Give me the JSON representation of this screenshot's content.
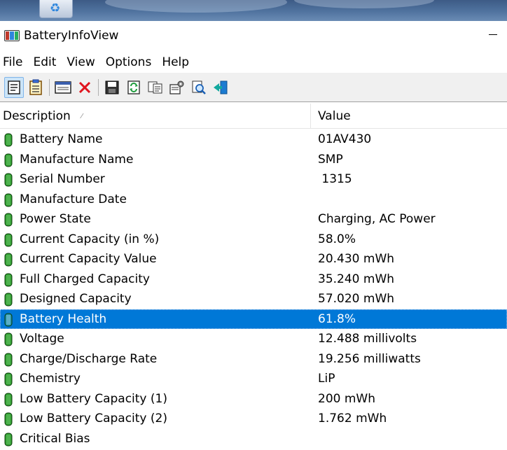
{
  "window": {
    "title": "BatteryInfoView"
  },
  "menu": [
    "File",
    "Edit",
    "View",
    "Options",
    "Help"
  ],
  "toolbar": {
    "buttons": [
      {
        "name": "properties-icon",
        "active": true
      },
      {
        "name": "clipboard-icon",
        "active": false
      },
      {
        "name": "html-report-icon",
        "active": false
      },
      {
        "name": "delete-icon",
        "active": false
      },
      {
        "name": "save-icon",
        "active": false
      },
      {
        "name": "refresh-icon",
        "active": false
      },
      {
        "name": "copy-icon",
        "active": false
      },
      {
        "name": "options-icon",
        "active": false
      },
      {
        "name": "find-icon",
        "active": false
      },
      {
        "name": "exit-icon",
        "active": false
      }
    ]
  },
  "list": {
    "columns": {
      "description": "Description",
      "value": "Value"
    },
    "rows": [
      {
        "description": "Battery Name",
        "value": "01AV430"
      },
      {
        "description": "Manufacture Name",
        "value": "SMP"
      },
      {
        "description": "Serial Number",
        "value": " 1315"
      },
      {
        "description": "Manufacture Date",
        "value": ""
      },
      {
        "description": "Power State",
        "value": "Charging, AC Power"
      },
      {
        "description": "Current Capacity (in %)",
        "value": "58.0%"
      },
      {
        "description": "Current Capacity Value",
        "value": "20.430 mWh"
      },
      {
        "description": "Full Charged Capacity",
        "value": "35.240 mWh"
      },
      {
        "description": "Designed Capacity",
        "value": "57.020 mWh"
      },
      {
        "description": "Battery Health",
        "value": "61.8%",
        "selected": true
      },
      {
        "description": "Voltage",
        "value": "12.488 millivolts"
      },
      {
        "description": "Charge/Discharge Rate",
        "value": "19.256 milliwatts"
      },
      {
        "description": "Chemistry",
        "value": "LiP"
      },
      {
        "description": "Low Battery Capacity (1)",
        "value": "200 mWh"
      },
      {
        "description": "Low Battery Capacity (2)",
        "value": "1.762 mWh"
      },
      {
        "description": "Critical Bias",
        "value": ""
      }
    ]
  },
  "colors": {
    "selection": "#0078d7",
    "battery": "#2f9e2f",
    "battery_selected": "#1a8fa0",
    "toolbar_bg": "#f0f0f0"
  }
}
